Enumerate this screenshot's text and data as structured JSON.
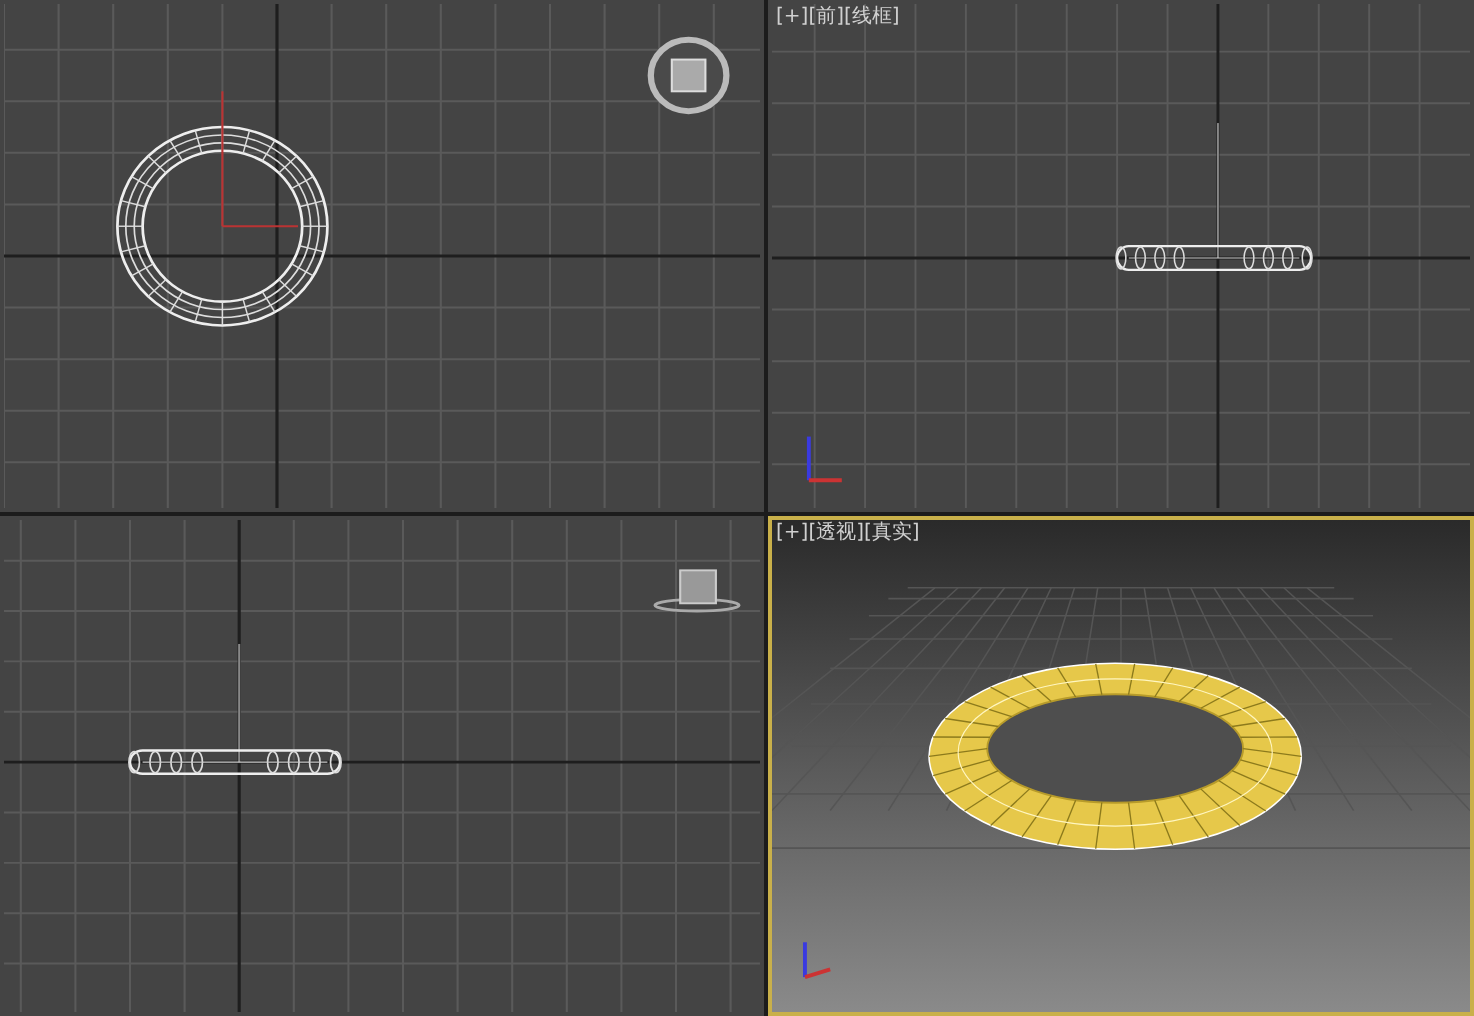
{
  "viewports": [
    {
      "kind": "top",
      "active": false
    },
    {
      "kind": "front",
      "labels": [
        "[+]",
        "[前]",
        "[线框]"
      ],
      "active": false
    },
    {
      "kind": "left",
      "active": false
    },
    {
      "kind": "perspective",
      "labels": [
        "[+]",
        "[透视]",
        "[真实]"
      ],
      "active": true
    }
  ]
}
